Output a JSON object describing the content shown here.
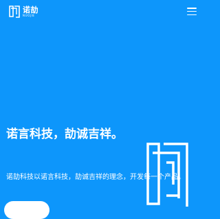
{
  "header": {
    "logo": {
      "name_cn": "诺劼",
      "name_en": "NUOJIE"
    },
    "menu_icon": "hamburger-menu-icon"
  },
  "hero": {
    "headline": "诺言科技，劼诚吉祥。",
    "subline": "诺劼科技以诺言科技，劼诚吉祥的理念，开发每一个产品。",
    "watermark_icon": "brand-logo-outline"
  },
  "colors": {
    "background": "#0d96fb",
    "foreground": "#ffffff"
  }
}
